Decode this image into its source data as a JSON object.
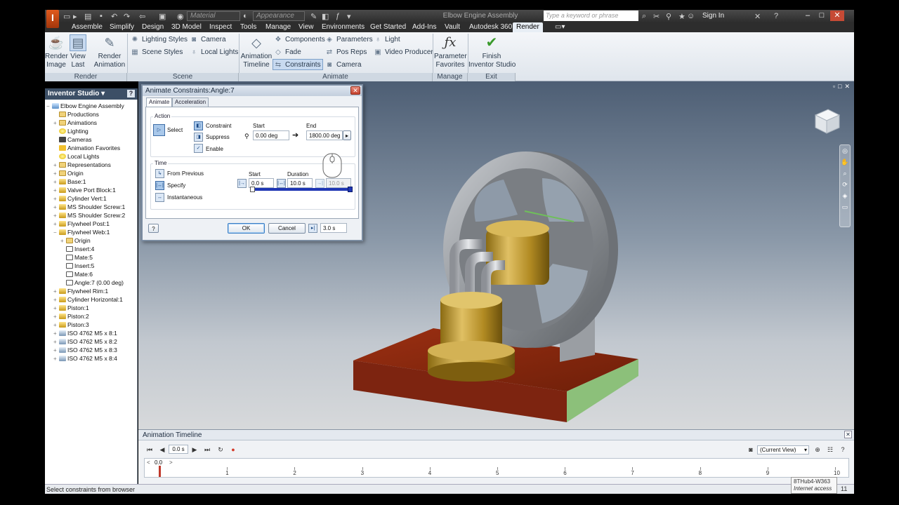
{
  "titlebar": {
    "logo": "I",
    "material_placeholder": "Material",
    "appearance_placeholder": "Appearance",
    "document_title": "Elbow Engine Assembly",
    "search_placeholder": "Type a keyword or phrase",
    "signin_label": "Sign In"
  },
  "ribbon_tabs": [
    "Assemble",
    "Simplify",
    "Design",
    "3D Model",
    "Inspect",
    "Tools",
    "Manage",
    "View",
    "Environments",
    "Get Started",
    "Add-Ins",
    "Vault",
    "Autodesk 360",
    "Render"
  ],
  "ribbon": {
    "render": {
      "render_image": "Render\nImage",
      "view_last": "View\nLast",
      "render_animation": "Render\nAnimation",
      "group": "Render"
    },
    "scene": {
      "lighting_styles": "Lighting Styles",
      "scene_styles": "Scene Styles",
      "camera": "Camera",
      "local_lights": "Local Lights",
      "group": "Scene"
    },
    "animate": {
      "animation_timeline": "Animation\nTimeline",
      "components": "Components",
      "fade": "Fade",
      "constraints": "Constraints",
      "parameters": "Parameters",
      "pos_reps": "Pos Reps",
      "camera": "Camera",
      "light": "Light",
      "video_producer": "Video Producer",
      "group": "Animate"
    },
    "manage": {
      "parameter_favorites": "Parameter\nFavorites",
      "group": "Manage"
    },
    "exit": {
      "finish": "Finish\nInventor Studio",
      "group": "Exit"
    }
  },
  "browser": {
    "title": "Inventor Studio",
    "help": "?",
    "items": [
      {
        "label": "Elbow Engine Assembly",
        "icon": "asm",
        "exp": "−",
        "indent": 0
      },
      {
        "label": "Productions",
        "icon": "folder",
        "exp": "",
        "indent": 1
      },
      {
        "label": "Animations",
        "icon": "folder",
        "exp": "+",
        "indent": 1
      },
      {
        "label": "Lighting",
        "icon": "light",
        "exp": "",
        "indent": 1
      },
      {
        "label": "Cameras",
        "icon": "cam",
        "exp": "",
        "indent": 1
      },
      {
        "label": "Animation Favorites",
        "icon": "star",
        "exp": "",
        "indent": 1
      },
      {
        "label": "Local Lights",
        "icon": "light",
        "exp": "",
        "indent": 1
      },
      {
        "label": "Representations",
        "icon": "folder",
        "exp": "+",
        "indent": 1
      },
      {
        "label": "Origin",
        "icon": "folder",
        "exp": "+",
        "indent": 1
      },
      {
        "label": "Base:1",
        "icon": "part",
        "exp": "+",
        "indent": 1
      },
      {
        "label": "Valve Port Block:1",
        "icon": "part",
        "exp": "+",
        "indent": 1
      },
      {
        "label": "Cylinder Vert:1",
        "icon": "part",
        "exp": "+",
        "indent": 1
      },
      {
        "label": "MS Shoulder Screw:1",
        "icon": "part",
        "exp": "+",
        "indent": 1
      },
      {
        "label": "MS Shoulder Screw:2",
        "icon": "part",
        "exp": "+",
        "indent": 1
      },
      {
        "label": "Flywheel Post:1",
        "icon": "part",
        "exp": "+",
        "indent": 1
      },
      {
        "label": "Flywheel Web:1",
        "icon": "part",
        "exp": "−",
        "indent": 1
      },
      {
        "label": "Origin",
        "icon": "folder",
        "exp": "+",
        "indent": 2
      },
      {
        "label": "Insert:4",
        "icon": "con",
        "exp": "",
        "indent": 2
      },
      {
        "label": "Mate:5",
        "icon": "con",
        "exp": "",
        "indent": 2
      },
      {
        "label": "Insert:5",
        "icon": "con",
        "exp": "",
        "indent": 2
      },
      {
        "label": "Mate:6",
        "icon": "con",
        "exp": "",
        "indent": 2
      },
      {
        "label": "Angle:7 (0.00 deg)",
        "icon": "con",
        "exp": "",
        "indent": 2
      },
      {
        "label": "Flywheel Rim:1",
        "icon": "part",
        "exp": "+",
        "indent": 1
      },
      {
        "label": "Cylinder Horizontal:1",
        "icon": "part",
        "exp": "+",
        "indent": 1
      },
      {
        "label": "Piston:1",
        "icon": "part",
        "exp": "+",
        "indent": 1
      },
      {
        "label": "Piston:2",
        "icon": "part",
        "exp": "+",
        "indent": 1
      },
      {
        "label": "Piston:3",
        "icon": "part",
        "exp": "+",
        "indent": 1
      },
      {
        "label": "ISO 4762 M5 x 8:1",
        "icon": "bolt",
        "exp": "+",
        "indent": 1
      },
      {
        "label": "ISO 4762 M5 x 8:2",
        "icon": "bolt",
        "exp": "+",
        "indent": 1
      },
      {
        "label": "ISO 4762 M5 x 8:3",
        "icon": "bolt",
        "exp": "+",
        "indent": 1
      },
      {
        "label": "ISO 4762 M5 x 8:4",
        "icon": "bolt",
        "exp": "+",
        "indent": 1
      }
    ]
  },
  "dialog": {
    "title": "Animate Constraints:Angle:7",
    "close": "✕",
    "tabs": [
      "Animate",
      "Acceleration"
    ],
    "action_label": "Action",
    "select_label": "Select",
    "constraint_label": "Constraint",
    "suppress_label": "Suppress",
    "enable_label": "Enable",
    "start_label": "Start",
    "end_label": "End",
    "start_value": "0.00 deg",
    "end_value": "1800.00 deg",
    "time_label": "Time",
    "from_previous_label": "From Previous",
    "specify_label": "Specify",
    "instantaneous_label": "Instantaneous",
    "time_start_label": "Start",
    "duration_label": "Duration",
    "time_start_value": "0.0 s",
    "duration_value": "10.0 s",
    "time_end_value": "10.0 s",
    "help": "?",
    "ok": "OK",
    "cancel": "Cancel",
    "bottom_value": "3.0 s"
  },
  "timeline": {
    "title": "Animation Timeline",
    "current_time": "0.0 s",
    "view_option": "(Current View)",
    "ruler_value": "0.0",
    "ticks": [
      "1",
      "2",
      "3",
      "4",
      "5",
      "6",
      "7",
      "8",
      "9",
      "10"
    ]
  },
  "status": {
    "message": "Select constraints from browser",
    "tooltip_line1": "8THub4-W363",
    "tooltip_line2": "Internet access",
    "number": "11"
  },
  "colors": {
    "ribbon_bg": "#e4e9ef",
    "browser_head": "#3c4f66",
    "accent": "#1f37b4",
    "viewport_top": "#4d5e74",
    "viewport_bottom": "#d7d9db"
  }
}
